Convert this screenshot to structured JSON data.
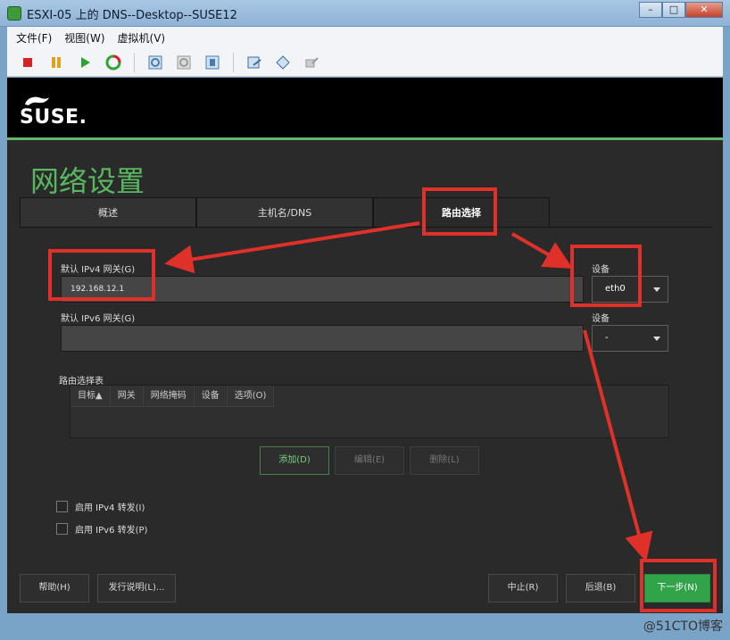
{
  "window": {
    "title": "ESXI-05 上的 DNS--Desktop--SUSE12",
    "minimize": "–",
    "maximize": "□",
    "close": "✕"
  },
  "menu": {
    "file": "文件(F)",
    "view": "视图(W)",
    "vm": "虚拟机(V)"
  },
  "toolbar": {
    "icons": [
      "stop-icon",
      "pause-icon",
      "play-icon",
      "reset-icon",
      "snapshot-icon",
      "revert-icon",
      "manage-snapshot-icon",
      "settings-icon",
      "tools-icon",
      "wrench-icon"
    ]
  },
  "brand": {
    "logo": "SUSE."
  },
  "page": {
    "title": "网络设置"
  },
  "tabs": [
    {
      "label": "概述",
      "active": false
    },
    {
      "label": "主机名/DNS",
      "active": false
    },
    {
      "label": "路由选择",
      "active": true
    }
  ],
  "routing": {
    "ipv4_label": "默认 IPv4 网关(G)",
    "ipv4_value": "192.168.12.1",
    "ipv4_device_label": "设备",
    "ipv4_device": "eth0",
    "ipv6_label": "默认 IPv6 网关(G)",
    "ipv6_value": "",
    "ipv6_device_label": "设备",
    "ipv6_device": "-",
    "table_label": "路由选择表",
    "columns": [
      "目标▲",
      "网关",
      "网络掩码",
      "设备",
      "选项(O)"
    ],
    "add": "添加(D)",
    "edit": "编辑(E)",
    "delete": "删除(L)",
    "ipv4_forward": "启用 IPv4 转发(I)",
    "ipv6_forward": "启用 IPv6 转发(P)"
  },
  "footer": {
    "help": "帮助(H)",
    "release_notes": "发行说明(L)...",
    "abort": "中止(R)",
    "back": "后退(B)",
    "next": "下一步(N)"
  },
  "watermark": "@51CTO博客",
  "colors": {
    "accent_green": "#58b85f",
    "annotation_red": "#e0302a",
    "next_button": "#31a349"
  }
}
